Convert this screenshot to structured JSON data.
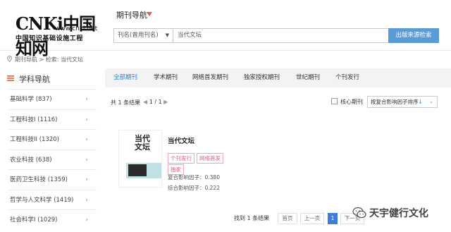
{
  "logo": {
    "brand": "CNKi中国知网",
    "url": "www.cnki.net",
    "subtitle": "中国知识基础设施工程"
  },
  "header": {
    "nav_title": "期刊导航"
  },
  "search": {
    "field_select": "刊名(曾用刊名)",
    "query": "当代文坛",
    "button": "出版来源检索"
  },
  "breadcrumb": {
    "text": "期刊导航 > 检索: 当代文坛"
  },
  "sidebar": {
    "title": "学科导航",
    "items": [
      {
        "label": "基础科学 (837)"
      },
      {
        "label": "工程科技I (1116)"
      },
      {
        "label": "工程科技II (1320)"
      },
      {
        "label": "农业科技 (638)"
      },
      {
        "label": "医药卫生科技 (1359)"
      },
      {
        "label": "哲学与人文科学 (1419)"
      },
      {
        "label": "社会科学I (1029)"
      }
    ]
  },
  "tabs": [
    "全部期刊",
    "学术期刊",
    "网络首发期刊",
    "独家授权期刊",
    "世纪期刊",
    "个刊发行"
  ],
  "results": {
    "count_text": "共 1 条结果",
    "page_text": "1 / 1",
    "core_label": "核心期刊",
    "sort_label": "按复合影响因子排序"
  },
  "journal": {
    "title": "当代文坛",
    "tags": [
      "个刊发行",
      "网络首发",
      "独家"
    ],
    "impact_composite": "复合影响因子：0.380",
    "impact_comprehensive": "综合影响因子：0.222",
    "cover_text": "当代文坛"
  },
  "pager": {
    "found_text": "找到 1 条结果",
    "first": "首页",
    "prev": "上一页",
    "current": "1",
    "next": "下一页"
  },
  "watermark": {
    "text": "天宇健行文化"
  },
  "colors": {
    "accent": "#2d7bd3",
    "search_button": "#5b9bd5",
    "tag": "#e2558f",
    "nav_arrow": "#e0603c"
  }
}
